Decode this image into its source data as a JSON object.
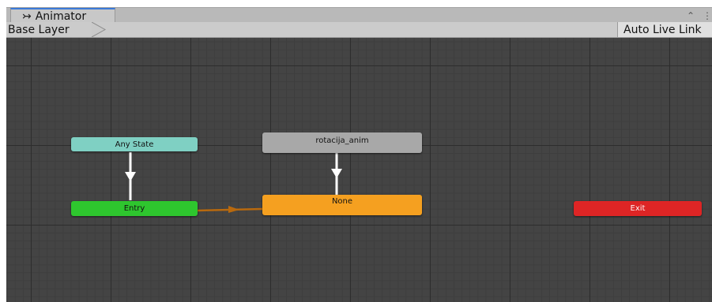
{
  "window": {
    "tab": {
      "icon": "animator-icon",
      "icon_glyph": "↣",
      "label": "Animator"
    },
    "tab_icons": [
      {
        "name": "lock-icon",
        "glyph": "⌃"
      },
      {
        "name": "more-options-icon",
        "glyph": "⋮"
      }
    ]
  },
  "breadcrumb": {
    "layer_label": "Base Layer"
  },
  "toolbar": {
    "auto_live_link_label": "Auto Live Link"
  },
  "graph": {
    "states": {
      "any_state": {
        "label": "Any State",
        "color": "#7fd0c3"
      },
      "entry": {
        "label": "Entry",
        "color": "#2ec62e"
      },
      "rotacija": {
        "label": "rotacija_anim",
        "color": "#a8a8a8"
      },
      "none": {
        "label": "None",
        "color": "#f5a020"
      },
      "exit": {
        "label": "Exit",
        "color": "#de2525"
      }
    },
    "colors": {
      "transition": "#ffffff",
      "default_transition": "#b8690e"
    }
  }
}
